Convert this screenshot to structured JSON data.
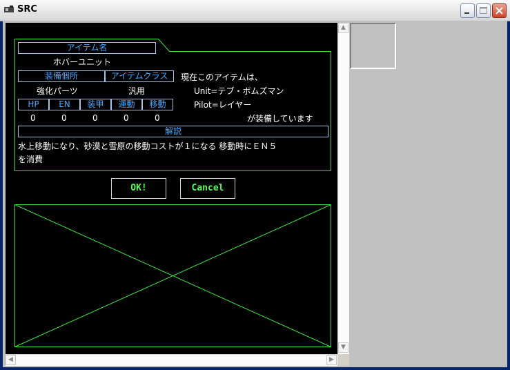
{
  "window": {
    "title": "SRC"
  },
  "item": {
    "name_header": "アイテム名",
    "name": "ホバーユニット",
    "slot_header": "装備個所",
    "class_header": "アイテムクラス",
    "slot": "強化パーツ",
    "class": "汎用",
    "stat_headers": [
      "HP",
      "EN",
      "装甲",
      "運動",
      "移動"
    ],
    "stat_values": [
      "0",
      "0",
      "0",
      "0",
      "0"
    ],
    "desc_header": "解説",
    "desc_line1": "水上移動になり、砂漠と雪原の移動コストが１になる 移動時にＥＮ５",
    "desc_line2": "を消費"
  },
  "equipped": {
    "line1": "現在このアイテムは、",
    "unit": "Unit=テブ・ボムズマン",
    "pilot": "Pilot=レイヤー",
    "line4": "が装備しています"
  },
  "buttons": {
    "ok": "OK!",
    "cancel": "Cancel"
  },
  "colors": {
    "frame_green": "#40e040",
    "header_blue": "#4aa9ff",
    "button_text": "#55ff55"
  }
}
